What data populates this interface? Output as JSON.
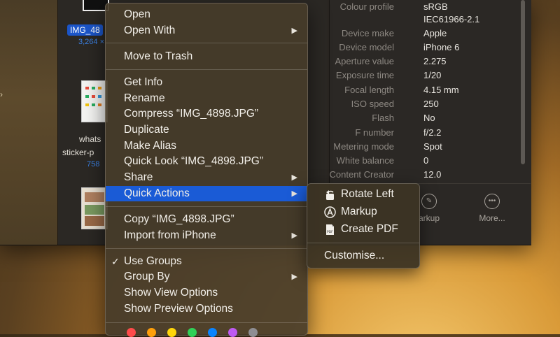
{
  "files": {
    "selected_name": "IMG_48",
    "selected_size": "3,264 ×",
    "file2_name_line1": "whats",
    "file2_name_line2": "sticker-p",
    "file2_size": "758"
  },
  "info_panel": {
    "rows": [
      {
        "key": "Colour profile",
        "value": "sRGB"
      },
      {
        "key": "",
        "value": "IEC61966-2.1"
      },
      {
        "key": "Device make",
        "value": "Apple"
      },
      {
        "key": "Device model",
        "value": "iPhone 6"
      },
      {
        "key": "Aperture value",
        "value": "2.275"
      },
      {
        "key": "Exposure time",
        "value": "1/20"
      },
      {
        "key": "Focal length",
        "value": "4.15 mm"
      },
      {
        "key": "ISO speed",
        "value": "250"
      },
      {
        "key": "Flash",
        "value": "No"
      },
      {
        "key": "F number",
        "value": "f/2.2"
      },
      {
        "key": "Metering mode",
        "value": "Spot"
      },
      {
        "key": "White balance",
        "value": "0"
      },
      {
        "key": "Content Creator",
        "value": "12.0"
      }
    ],
    "actions": [
      {
        "label": "arkup",
        "icon": "markup-icon"
      },
      {
        "label": "More...",
        "icon": "more-icon"
      }
    ]
  },
  "context_menu": {
    "items": {
      "open": "Open",
      "open_with": "Open With",
      "move_to_trash": "Move to Trash",
      "get_info": "Get Info",
      "rename": "Rename",
      "compress": "Compress “IMG_4898.JPG”",
      "duplicate": "Duplicate",
      "make_alias": "Make Alias",
      "quick_look": "Quick Look “IMG_4898.JPG”",
      "share": "Share",
      "quick_actions": "Quick Actions",
      "copy": "Copy “IMG_4898.JPG”",
      "import_from_iphone": "Import from iPhone",
      "use_groups": "Use Groups",
      "group_by": "Group By",
      "show_view_options": "Show View Options",
      "show_preview_options": "Show Preview Options"
    },
    "use_groups_checked": true,
    "tag_colors": [
      "#ff4b4b",
      "#ff9f0a",
      "#ffd60a",
      "#30d158",
      "#0a84ff",
      "#bf5af2",
      "#8e8e93"
    ]
  },
  "submenu": {
    "rotate_left": "Rotate Left",
    "markup": "Markup",
    "create_pdf": "Create PDF",
    "customise": "Customise..."
  }
}
